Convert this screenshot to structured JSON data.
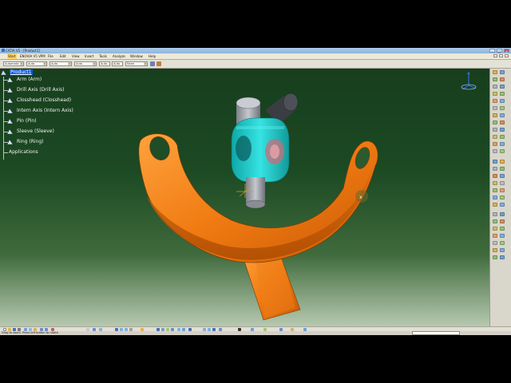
{
  "window": {
    "title": "CATIA V5 - [Product1]",
    "controls": [
      "–",
      "□",
      "×"
    ]
  },
  "menu": {
    "items": [
      "Start",
      "ENOVIA V5 VPM",
      "File",
      "Edit",
      "View",
      "Insert",
      "Tools",
      "Analyze",
      "Window",
      "Help"
    ]
  },
  "toolbar": {
    "combos": [
      "Automatic",
      "Auto",
      "Auto",
      "Auto",
      "Auto",
      "Auto",
      "None"
    ]
  },
  "tree": {
    "root": "Product1",
    "children": [
      "Arm (Arm)",
      "Drill Axis (Drill Axis)",
      "Closshead (Closshead)",
      "Intern Axis (Intern Axis)",
      "Pin (Pin)",
      "Sleeve (Sleeve)",
      "Ring (Ring)"
    ],
    "applications": "Applications"
  },
  "status": {
    "message": "Drag to zoom. Press left button to rotate"
  },
  "colors": {
    "viewport_bg": "#1c4a23",
    "arm": "#f07a12",
    "crosshead": "#19c9c9",
    "tree_selection": "#0a5ad8"
  },
  "icons": {
    "compass": "compass-icon",
    "product": "product-icon",
    "part": "part-icon"
  }
}
